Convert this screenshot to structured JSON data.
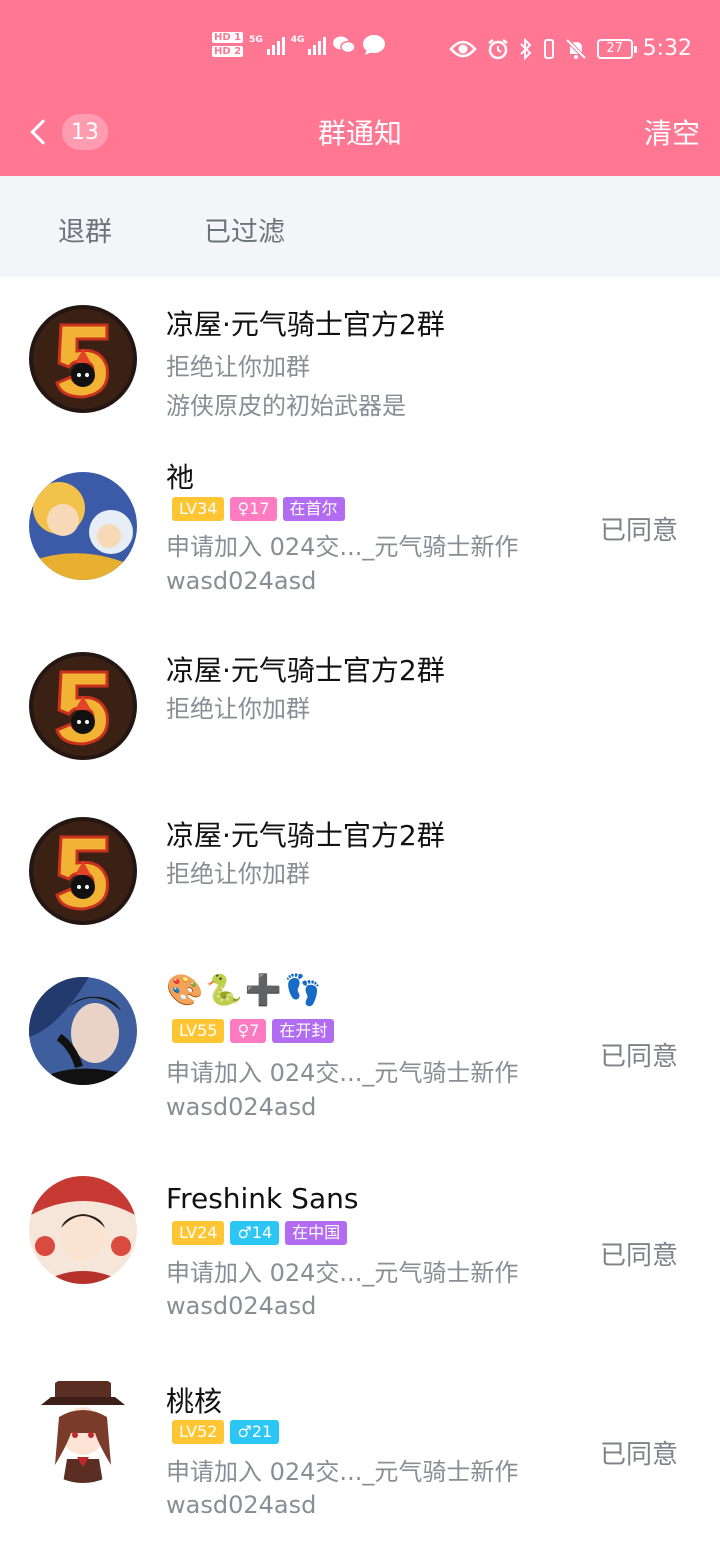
{
  "status_bar": {
    "hd1": "HD 1",
    "hd2": "HD 2",
    "net1": "5G",
    "net2": "4G",
    "battery": "27",
    "time": "5:32"
  },
  "nav": {
    "unread_count": "13",
    "title": "群通知",
    "clear_label": "清空"
  },
  "tabs": [
    "退群",
    "已过滤"
  ],
  "items": [
    {
      "name": "凉屋·元气骑士官方2群",
      "line1": "拒绝让你加群",
      "line2": "游侠原皮的初始武器是"
    },
    {
      "name": "祂",
      "level": "LV34",
      "gender_age": "♀17",
      "location": "在首尔",
      "line1": "申请加入 024交..._元气骑士新作",
      "line2": "wasd024asd",
      "status": "已同意"
    },
    {
      "name": "凉屋·元气骑士官方2群",
      "line1": "拒绝让你加群"
    },
    {
      "name": "凉屋·元气骑士官方2群",
      "line1": "拒绝让你加群"
    },
    {
      "name": "🎨🐍➕👣",
      "level": "LV55",
      "gender_age": "♀7",
      "location": "在开封",
      "line1": "申请加入 024交..._元气骑士新作",
      "line2": "wasd024asd",
      "status": "已同意"
    },
    {
      "name": "Freshink Sans",
      "level": "LV24",
      "gender_age": "♂14",
      "location": "在中国",
      "line1": "申请加入 024交..._元气骑士新作",
      "line2": "wasd024asd",
      "status": "已同意"
    },
    {
      "name": "桃核",
      "level": "LV52",
      "gender_age": "♂21",
      "line1": "申请加入 024交..._元气骑士新作",
      "line2": "wasd024asd",
      "status": "已同意"
    }
  ],
  "colors": {
    "header": "#FF7793",
    "tab_bg": "#F3F5F8",
    "level_tag": "#FFC532",
    "female_tag": "#FF7BC1",
    "male_tag": "#2CC6F5",
    "location_tag": "#B26CF2"
  },
  "icons": {
    "back": "chevron-left-icon",
    "eye": "eye-icon",
    "alarm": "alarm-icon",
    "bluetooth": "bluetooth-icon",
    "mute": "bell-off-icon",
    "wechat": "wechat-icon",
    "message": "chat-bubble-icon"
  }
}
